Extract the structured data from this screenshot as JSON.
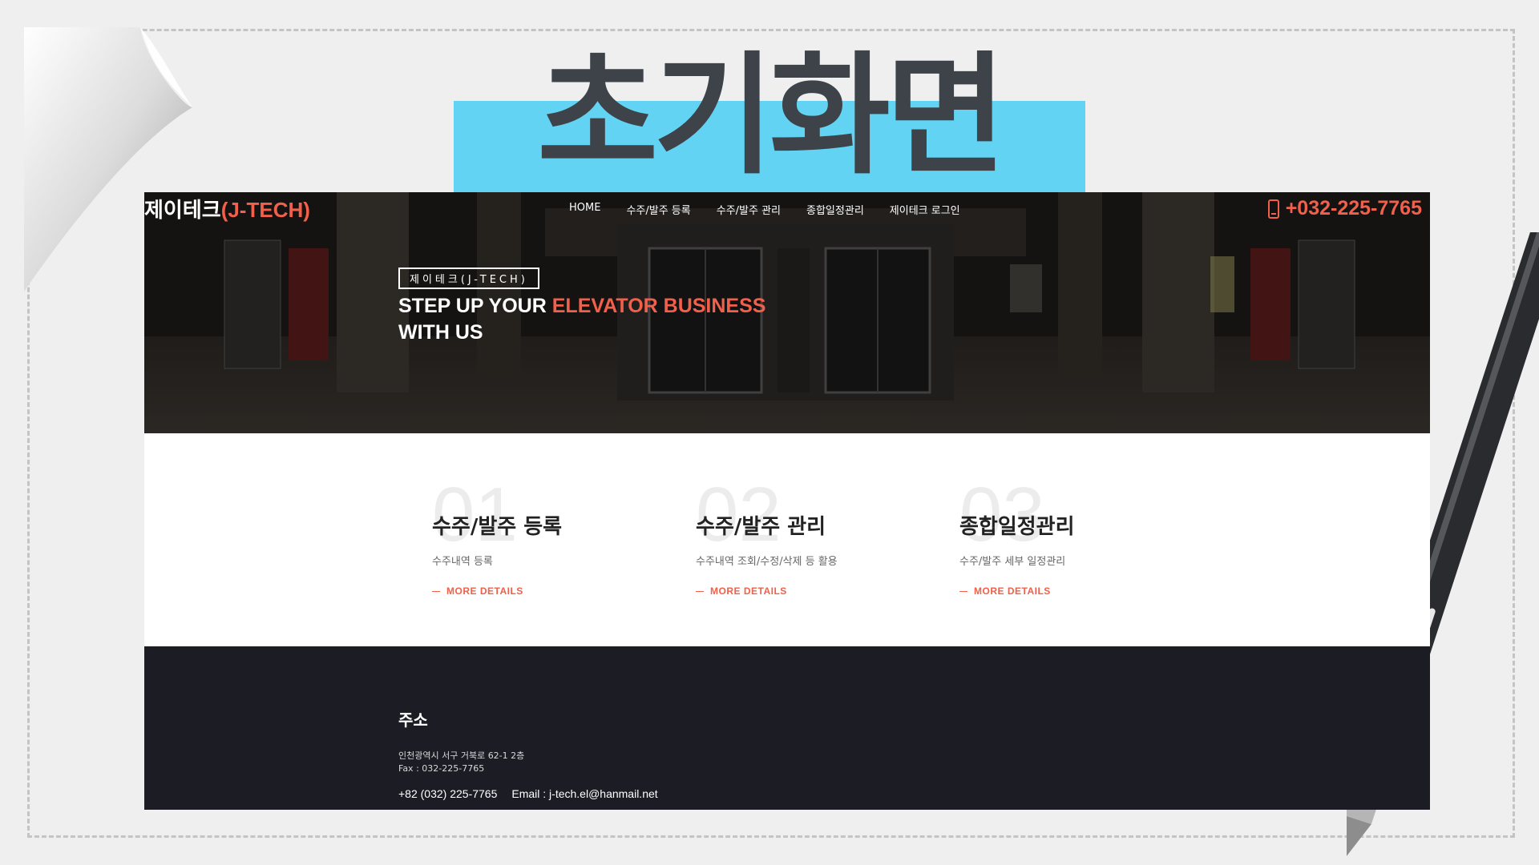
{
  "banner": {
    "title": "초기화면",
    "bar_color": "#62d3f2",
    "text_color": "#3d4349"
  },
  "site": {
    "logo_main": "제이테크",
    "logo_accent": "(J-TECH)",
    "nav": [
      "HOME",
      "수주/발주 등록",
      "수주/발주 관리",
      "종합일정관리",
      "제이테크 로그인"
    ],
    "phone": "+032-225-7765",
    "hero": {
      "badge": "제이테크(J-TECH)",
      "line1_white": "STEP UP YOUR ",
      "line1_accent": "ELEVATOR BUSINESS",
      "line2": "WITH US"
    },
    "features": [
      {
        "num": "01",
        "title": "수주/발주 등록",
        "desc": "수주내역 등록",
        "more": "MORE DETAILS"
      },
      {
        "num": "02",
        "title": "수주/발주 관리",
        "desc": "수주내역 조회/수정/삭제 등 활용",
        "more": "MORE DETAILS"
      },
      {
        "num": "03",
        "title": "종합일정관리",
        "desc": "수주/발주 세부 일정관리",
        "more": "MORE DETAILS"
      }
    ],
    "footer": {
      "title": "주소",
      "address": "인천광역시 서구 거북로 62-1 2층",
      "fax": "Fax : 032-225-7765",
      "phone": "+82 (032) 225-7765",
      "email": "Email : j-tech.el@hanmail.net"
    },
    "accent_color": "#f0604a"
  }
}
